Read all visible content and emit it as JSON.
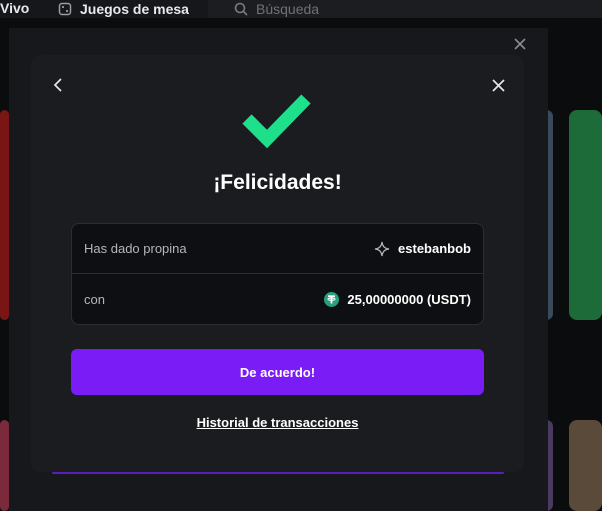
{
  "nav": {
    "live_label": "Vivo",
    "table_games_label": "Juegos de mesa",
    "search_placeholder": "Búsqueda"
  },
  "modal": {
    "title": "¡Felicidades!",
    "tip": {
      "label": "Has dado propina",
      "recipient": "estebanbob",
      "recipient_icon": "sparkle-icon"
    },
    "amount": {
      "label": "con",
      "value": "25,00000000 (USDT)",
      "currency_icon": "tether-icon",
      "currency_color": "#26a17b"
    },
    "confirm_button": "De acuerdo!",
    "history_link": "Historial de transacciones"
  },
  "colors": {
    "accent": "#7a1cf5",
    "success": "#1fe08a"
  }
}
